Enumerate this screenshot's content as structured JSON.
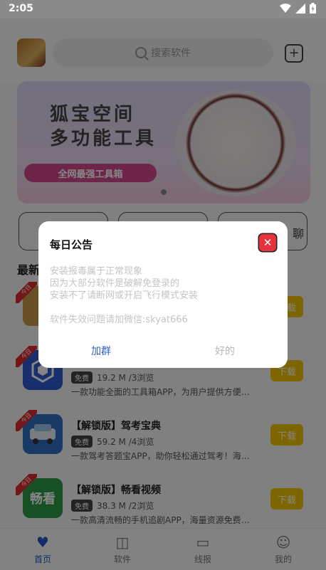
{
  "status_bar": {
    "time": "2:05"
  },
  "header": {
    "search_placeholder": "搜索软件",
    "add_icon": "plus-square-icon"
  },
  "banner": {
    "title_line1": "狐宝空间",
    "title_line2": "多功能工具",
    "subtitle": "全网最强工具箱"
  },
  "quick_links": {
    "third_label_partial": "聊"
  },
  "section": {
    "title_partial": "最新"
  },
  "apps": [
    {
      "name": "",
      "size_views": "",
      "description": "",
      "download": "下载",
      "tag": "今日",
      "icon_color": "#c59a4d"
    },
    {
      "name": "",
      "badge": "免费",
      "size_views": "19.2 M /3浏览",
      "description": "一款功能全面的工具箱APP，为用户提供方便快…",
      "download": "下载",
      "tag": "今日",
      "icon_color": "#2e5ad2"
    },
    {
      "name": "【解锁版】驾考宝典",
      "badge": "免费",
      "size_views": "59.2 M /4浏览",
      "description": "一款驾考答题宝APP，助你轻松通过驾考！海量…",
      "download": "下载",
      "tag": "今日",
      "icon_color": "#2e6fc0"
    },
    {
      "name": "【解锁版】畅看视频",
      "badge": "免费",
      "size_views": "38.3 M /2浏览",
      "description": "一款高清流畅的手机追剧APP，海量资源免费任…",
      "download": "下载",
      "tag": "今日",
      "icon_color": "#2e9a4a",
      "icon_text": "畅看"
    }
  ],
  "tabbar": {
    "home": "首页",
    "software": "软件",
    "report": "线报",
    "mine": "我的"
  },
  "dialog": {
    "title": "每日公告",
    "lines": [
      "安装报毒属于正常现象",
      "因为大部分软件是破解免登录的",
      "安装不了请断网或开启飞行模式安装",
      "软件失效问题请加微信:skyat666"
    ],
    "join_button": "加群",
    "ok_button": "好的",
    "close_icon": "close-icon"
  },
  "colors": {
    "accent": "#1f56c8",
    "download": "#f0c400",
    "close": "#e6323c",
    "join": "#2e62c9"
  }
}
